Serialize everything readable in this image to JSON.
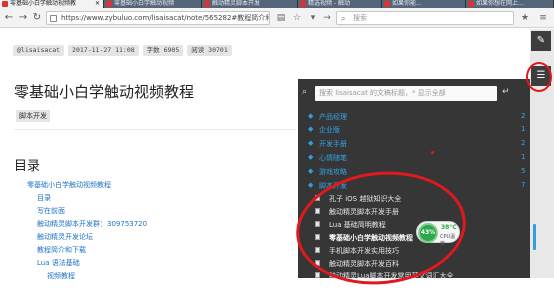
{
  "browser": {
    "tabs": [
      {
        "label": "零基础小白学触动视频教",
        "active": true
      },
      {
        "label": "零基础小白学触动视频",
        "active": false
      },
      {
        "label": "触动精灵脚本开发",
        "active": false
      },
      {
        "label": "精选视频 - 触动",
        "active": false
      },
      {
        "label": "如果你能...",
        "active": false
      },
      {
        "label": "如果你想在网上...",
        "active": false
      }
    ],
    "url": "https://www.zybuluo.com/lisaisacat/note/565282#教程简介和下载",
    "search_placeholder": "搜索",
    "nav_icons": {
      "back": "back-arrow-icon",
      "forward": "forward-arrow-icon",
      "refresh": "refresh-icon"
    }
  },
  "article": {
    "author_chip": "@lisaisacat",
    "date_chip": "2017-11-27 11:08",
    "words_chip": "字数 6905",
    "reads_chip": "阅读 30701",
    "title": "零基础小白学触动视频教程",
    "tag": "脚本开发",
    "toc_heading": "目录",
    "toc": [
      {
        "label": "零基础小白学触动视频教程",
        "level": 0
      },
      {
        "label": "目录",
        "level": 1
      },
      {
        "label": "写在前面",
        "level": 1
      },
      {
        "label": "触动精灵脚本开发群：309753720",
        "level": 1
      },
      {
        "label": "触动精灵开发论坛",
        "level": 1
      },
      {
        "label": "教程简介和下载",
        "level": 1
      },
      {
        "label": "Lua 语法基础",
        "level": 1
      },
      {
        "label": "视频教程",
        "level": 2
      }
    ]
  },
  "panel": {
    "search_placeholder": "搜索 lisaisacat 的文稿标题，* 显示全部",
    "categories": [
      {
        "label": "产品经理",
        "count": "2"
      },
      {
        "label": "企业版",
        "count": "1"
      },
      {
        "label": "开发手册",
        "count": "2"
      },
      {
        "label": "心情随笔",
        "count": "1"
      },
      {
        "label": "游戏攻略",
        "count": "5"
      },
      {
        "label": "脚本开发",
        "count": "7"
      }
    ],
    "notes": [
      {
        "label": "孔子 iOS 越狱知识大全",
        "bold": false
      },
      {
        "label": "触动精灵脚本开发手册",
        "bold": false
      },
      {
        "label": "Lua 基础简明教程",
        "bold": false
      },
      {
        "label": "零基础小白学触动视频教程",
        "bold": true
      },
      {
        "label": "手机脚本开发实用技巧",
        "bold": false
      },
      {
        "label": "触动精灵脚本开发百科",
        "bold": false
      },
      {
        "label": "触动精灵Lua脚本开发常用英文词汇大全",
        "bold": false
      }
    ]
  },
  "widget": {
    "percent": "43%",
    "temp": "38°C",
    "label": "CPU温度"
  },
  "colors": {
    "accent": "#2f9fe0",
    "panel_bg": "#363636",
    "annotation": "#e0191e",
    "widget_green": "#2ea84a"
  }
}
